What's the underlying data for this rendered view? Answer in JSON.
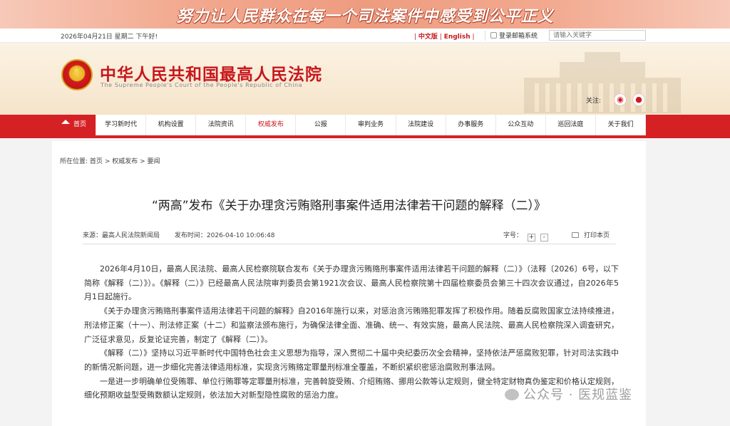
{
  "banner": {
    "slogan": "努力让人民群众在每一个司法案件中感受到公平正义"
  },
  "topbar": {
    "date": "2026年04月21日  星期二    下午好!",
    "lang_cn": "中文版",
    "lang_sep": " | ",
    "lang_en": "English",
    "login": "登录邮箱系统",
    "search_placeholder": "请输入关键字"
  },
  "header": {
    "title_cn": "中华人民共和国最高人民法院",
    "title_en": "The Supreme People's Court of the People's Republic of China",
    "follow_label": "关注:",
    "follow_icons": [
      "weibo-icon",
      "wechat-icon"
    ]
  },
  "nav": {
    "items": [
      "首页",
      "学习新时代",
      "机构设置",
      "法院资讯",
      "权威发布",
      "公报",
      "审判业务",
      "法院建设",
      "办事服务",
      "公众互动",
      "巡回法庭",
      "关于我们"
    ]
  },
  "breadcrumb": {
    "prefix": "所在位置:",
    "items": [
      "首页",
      "权威发布",
      "要闻"
    ],
    "separator": ">"
  },
  "article": {
    "title": "“两高”发布《关于办理贪污贿赂刑事案件适用法律若干问题的解释（二）》",
    "source": "来源：最高人民法院新闻局",
    "time": "发布时间：2026-04-10 10:06:48",
    "font_size_label": "字号：",
    "font_plus": "+",
    "font_minus": "-",
    "print_label": "打印本页",
    "paragraphs": [
      "2026年4月10日，最高人民法院、最高人民检察院联合发布《关于办理贪污贿赂刑事案件适用法律若干问题的解释（二）》（法释〔2026〕6号，以下简称《解释（二）》）。《解释（二）》已经最高人民法院审判委员会第1921次会议、最高人民检察院第十四届检察委员会第三十四次会议通过，自2026年5月1日起施行。",
      "《关于办理贪污贿赂刑事案件适用法律若干问题的解释》自2016年施行以来，对惩治贪污贿赂犯罪发挥了积极作用。随着反腐败国家立法持续推进，刑法修正案（十一）、刑法修正案（十二）和监察法颁布施行，为确保法律全面、准确、统一、有效实施，最高人民法院、最高人民检察院深入调查研究，广泛征求意见，反复论证完善，制定了《解释（二）》。",
      "《解释（二）》坚持以习近平新时代中国特色社会主义思想为指导，深入贯彻二十届中央纪委历次全会精神，坚持依法严惩腐败犯罪，针对司法实践中的新情况新问题，进一步细化完善法律适用标准，实现贪污贿赂定罪量刑标准全覆盖，不断织紧织密惩治腐败刑事法网。",
      "一是进一步明确单位受贿罪、单位行贿罪等定罪量刑标准，完善斡旋受贿、介绍贿赂、挪用公款等认定规则，健全特定财物真伪鉴定和价格认定规则，细化预期收益型受贿数额认定规则，依法加大对新型隐性腐败的惩治力度。"
    ]
  },
  "watermark": {
    "text": "公众号 · 医规蓝鉴"
  }
}
